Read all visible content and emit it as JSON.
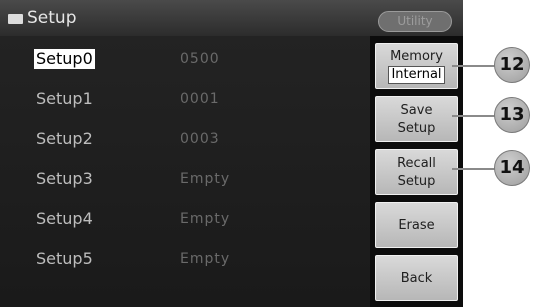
{
  "titlebar": {
    "title": "Setup",
    "title_icon": "folder-icon",
    "utility_label": "Utility"
  },
  "slots": [
    {
      "name": "Setup0",
      "value": "0500",
      "selected": true
    },
    {
      "name": "Setup1",
      "value": "0001",
      "selected": false
    },
    {
      "name": "Setup2",
      "value": "0003",
      "selected": false
    },
    {
      "name": "Setup3",
      "value": "Empty",
      "selected": false
    },
    {
      "name": "Setup4",
      "value": "Empty",
      "selected": false
    },
    {
      "name": "Setup5",
      "value": "Empty",
      "selected": false
    }
  ],
  "softkeys": {
    "memory": {
      "label": "Memory",
      "value": "Internal"
    },
    "save": {
      "line1": "Save",
      "line2": "Setup"
    },
    "recall": {
      "line1": "Recall",
      "line2": "Setup"
    },
    "erase": {
      "label": "Erase"
    },
    "back": {
      "label": "Back"
    }
  },
  "callouts": [
    "12",
    "13",
    "14"
  ],
  "colors": {
    "screen_bg": "#000000",
    "softkey_bg": "#c8c8c8",
    "selected_bg": "#ffffff"
  }
}
